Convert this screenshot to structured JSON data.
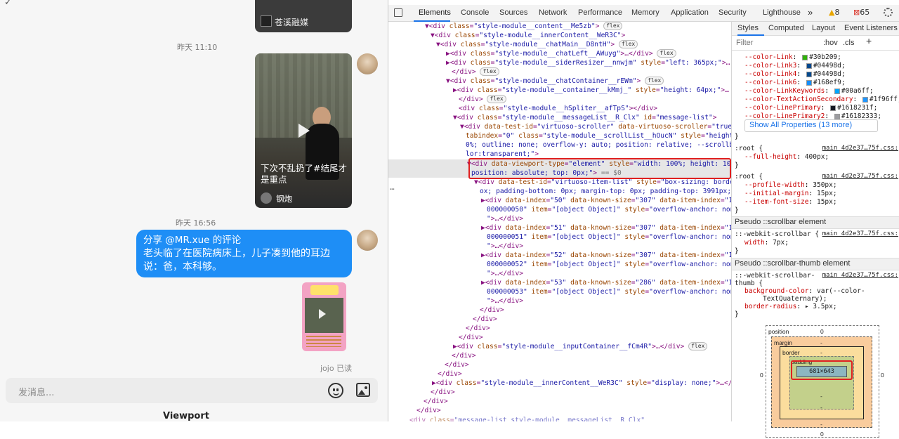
{
  "chat": {
    "top_card_source": "苍溪融媒",
    "time1": "昨天 11:10",
    "video_caption": "下次不乱扔了#结尾才是重点",
    "video_author": "钢炮",
    "time2": "昨天 16:56",
    "share_line": "分享 @MR.xue 的评论",
    "share_text": "老头临了在医院病床上，儿子凑到他的耳边说：爸，本科够。",
    "read_status": "jojo 已读",
    "input_placeholder": "发消息...",
    "viewport_label": "Viewport"
  },
  "devtools": {
    "tabs": [
      "Elements",
      "Console",
      "Sources",
      "Network",
      "Performance",
      "Memory",
      "Application",
      "Security",
      "Lighthouse"
    ],
    "more": "»",
    "warnings": "8",
    "errors": "65",
    "styles_tabs": [
      "Styles",
      "Computed",
      "Layout",
      "Event Listeners"
    ],
    "filter_placeholder": "Filter",
    "hov": ":hov",
    "cls": ".cls",
    "show_all": "Show All Properties (13 more)",
    "pseudo1": "Pseudo ::scrollbar element",
    "pseudo2": "Pseudo ::scrollbar-thumb element",
    "box_model": {
      "position": "position",
      "margin": "margin",
      "border": "border",
      "padding": "padding",
      "content": "681×643",
      "zero": "0",
      "dash": "-"
    }
  },
  "colors": {
    "accent": "#1e8ef6",
    "highlight": "#e02020"
  }
}
